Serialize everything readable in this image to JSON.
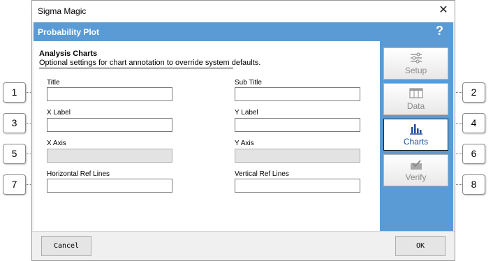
{
  "window": {
    "title": "Sigma Magic",
    "close_glyph": "✕"
  },
  "header": {
    "title": "Probability Plot",
    "help": "?"
  },
  "section": {
    "title": "Analysis Charts",
    "description": "Optional settings for chart annotation to override system defaults."
  },
  "fields": {
    "title": {
      "label": "Title",
      "value": ""
    },
    "subtitle": {
      "label": "Sub Title",
      "value": ""
    },
    "xlabel": {
      "label": "X Label",
      "value": ""
    },
    "ylabel": {
      "label": "Y Label",
      "value": ""
    },
    "xaxis": {
      "label": "X Axis",
      "value": ""
    },
    "yaxis": {
      "label": "Y Axis",
      "value": ""
    },
    "href": {
      "label": "Horizontal Ref Lines",
      "value": ""
    },
    "vref": {
      "label": "Vertical Ref Lines",
      "value": ""
    }
  },
  "nav": {
    "setup": "Setup",
    "data": "Data",
    "charts": "Charts",
    "verify": "Verify"
  },
  "footer": {
    "cancel": "Cancel",
    "ok": "OK"
  },
  "callouts": [
    "1",
    "2",
    "3",
    "4",
    "5",
    "6",
    "7",
    "8"
  ],
  "colors": {
    "accent": "#5b9bd5",
    "active_label": "#1f4e9a"
  }
}
